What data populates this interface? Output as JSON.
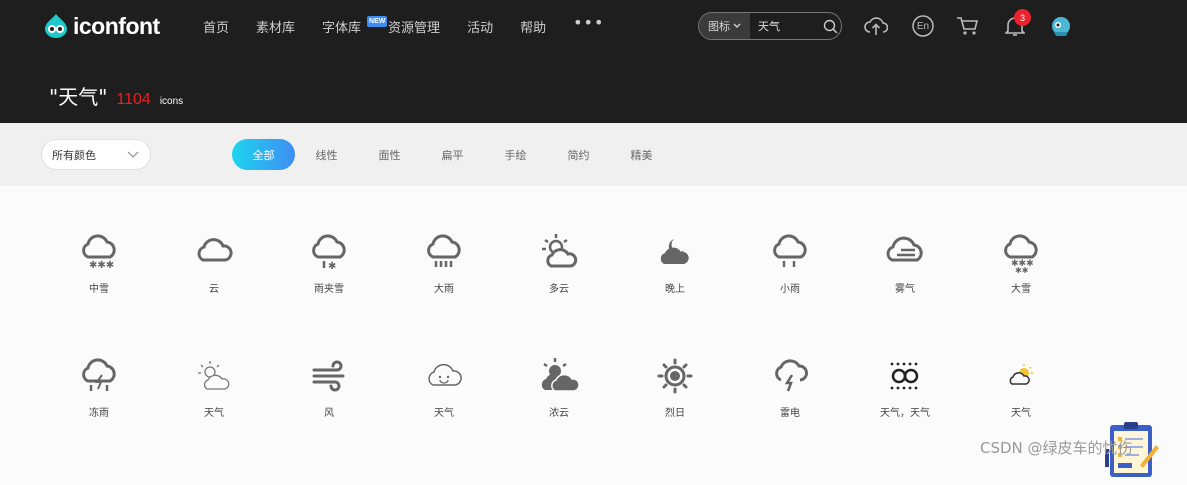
{
  "header": {
    "logo_text": "iconfont",
    "nav": [
      {
        "label": "首页"
      },
      {
        "label": "素材库"
      },
      {
        "label": "字体库",
        "badge": "NEW"
      },
      {
        "label": "资源管理"
      },
      {
        "label": "活动"
      },
      {
        "label": "帮助"
      }
    ],
    "nav_more": "•••",
    "search": {
      "type": "图标",
      "value": "天气"
    },
    "tools": {
      "lang_label": "En",
      "notifications": "3"
    }
  },
  "result": {
    "query": "\"天气\"",
    "count": "1104",
    "unit": "icons"
  },
  "filters": {
    "color_select": "所有颜色",
    "tabs": [
      "全部",
      "线性",
      "面性",
      "扁平",
      "手绘",
      "简约",
      "精美"
    ],
    "active_tab": 0
  },
  "icons": [
    {
      "label": "中雪",
      "icon": "snow-cloud-icon"
    },
    {
      "label": "云",
      "icon": "cloud-icon"
    },
    {
      "label": "雨夹雪",
      "icon": "sleet-icon"
    },
    {
      "label": "大雨",
      "icon": "heavy-rain-icon"
    },
    {
      "label": "多云",
      "icon": "partly-cloudy-icon"
    },
    {
      "label": "晚上",
      "icon": "night-icon"
    },
    {
      "label": "小雨",
      "icon": "light-rain-icon"
    },
    {
      "label": "雾气",
      "icon": "fog-icon"
    },
    {
      "label": "大雪",
      "icon": "heavy-snow-icon"
    },
    {
      "label": "冻雨",
      "icon": "freezing-rain-icon"
    },
    {
      "label": "天气",
      "icon": "sun-cloud-outline-icon"
    },
    {
      "label": "风",
      "icon": "wind-icon"
    },
    {
      "label": "天气",
      "icon": "smile-cloud-icon"
    },
    {
      "label": "浓云",
      "icon": "dense-cloud-icon"
    },
    {
      "label": "烈日",
      "icon": "sun-icon"
    },
    {
      "label": "雷电",
      "icon": "thunder-icon"
    },
    {
      "label": "天气，天气",
      "icon": "dots-weather-icon"
    },
    {
      "label": "天气",
      "icon": "colored-sun-cloud-icon"
    }
  ],
  "watermark": "CSDN @绿皮车的忧伤",
  "colors": {
    "accent_start": "#1ed5ee",
    "accent_end": "#3e8df3",
    "badge": "#e8232f",
    "count": "#ef1e1e"
  }
}
